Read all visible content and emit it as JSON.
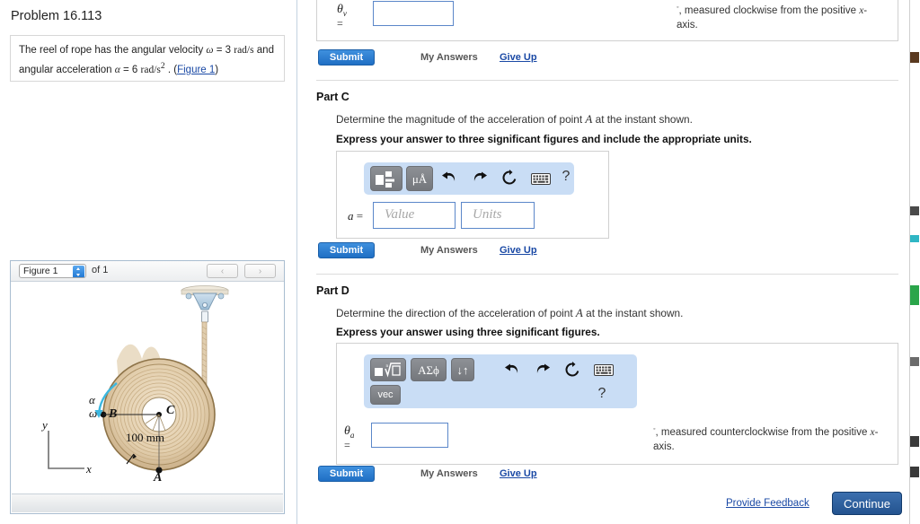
{
  "left": {
    "problem_title": "Problem 16.113",
    "problem_statement_1": "The reel of rope has the angular velocity ",
    "omega_sym": "ω",
    "omega_val": " = 3 ",
    "omega_unit": "rad/s",
    "problem_statement_2": " and angular acceleration ",
    "alpha_sym": "α",
    "alpha_val": " = 6 ",
    "alpha_unit": "rad/s",
    "alpha_exp": "2",
    "problem_statement_3": " . (",
    "figure_link": "Figure 1",
    "problem_statement_4": ")",
    "figure_select_value": "Figure 1",
    "figure_of": "of 1",
    "nav_prev": "‹",
    "nav_next": "›",
    "figure_labels": {
      "alpha": "α",
      "omega": "ω",
      "point_b": "B",
      "point_c": "C",
      "point_a": "A",
      "radius": "100 mm",
      "axis_y": "y",
      "axis_x": "x"
    }
  },
  "partB_tail": {
    "theta_symbol": "θ",
    "theta_sub": "v",
    "equals": "=",
    "note": ", measured clockwise from the positive ",
    "note_var": "x",
    "note_end": "-axis.",
    "submit": "Submit",
    "my_answers": "My Answers",
    "give_up": "Give Up"
  },
  "partC": {
    "heading": "Part C",
    "question": "Determine the magnitude of the acceleration of point ",
    "question_var": "A",
    "question_end": " at the instant shown.",
    "instruction": "Express your answer to three significant figures and include the appropriate units.",
    "toolbar": {
      "template_icon": "template-icon",
      "units_icon": "μÅ",
      "undo_icon": "←",
      "redo_icon": "→",
      "reset_icon": "↻",
      "keyboard_icon": "keyboard-icon",
      "help_icon": "?"
    },
    "answer_label": "a",
    "equals": "=",
    "value_placeholder": "Value",
    "units_placeholder": "Units",
    "value_text": "",
    "units_text": "",
    "submit": "Submit",
    "my_answers": "My Answers",
    "give_up": "Give Up"
  },
  "partD": {
    "heading": "Part D",
    "question": "Determine the direction of the acceleration of point ",
    "question_var": "A",
    "question_end": " at the instant shown.",
    "instruction": "Express your answer using three significant figures.",
    "toolbar": {
      "template_icon": "root-template-icon",
      "greek_icon": "ΑΣϕ",
      "arrows_icon": "↓↑",
      "vec_icon": "vec",
      "undo_icon": "←",
      "redo_icon": "→",
      "reset_icon": "↻",
      "keyboard_icon": "keyboard-icon",
      "help_icon": "?"
    },
    "theta_symbol": "θ",
    "theta_sub": "a",
    "equals": "=",
    "answer_text": "",
    "note": ", measured counterclockwise from the positive ",
    "note_var": "x",
    "note_end": "-axis.",
    "submit": "Submit",
    "my_answers": "My Answers",
    "give_up": "Give Up"
  },
  "footer": {
    "provide_feedback": "Provide Feedback",
    "continue": "Continue"
  },
  "colors": {
    "accent_blue": "#1f6fc4",
    "link_blue": "#1a49a5",
    "toolbar_blue": "#c9ddf5",
    "continue_blue": "#24538f",
    "input_border": "#5b87c9"
  }
}
